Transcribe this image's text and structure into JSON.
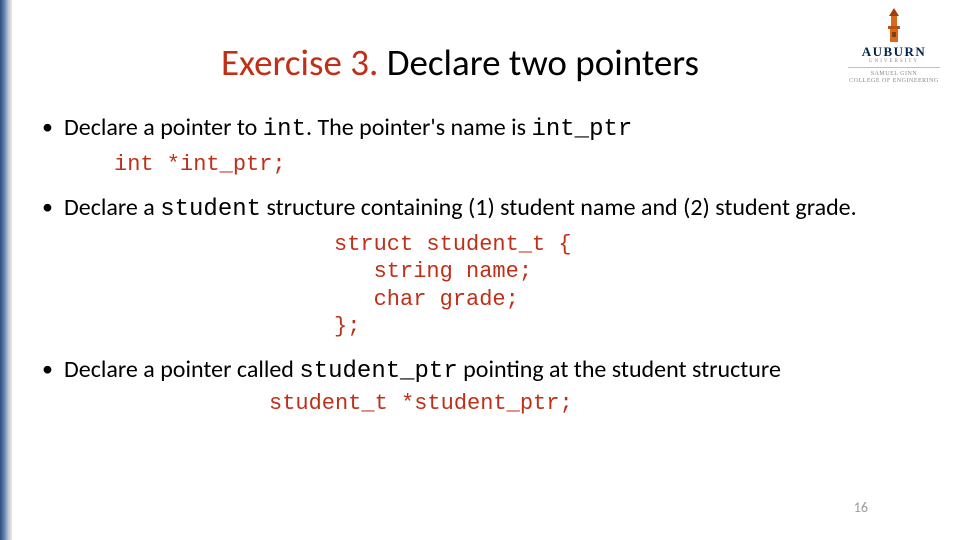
{
  "logo": {
    "word": "AUBURN",
    "sub": "UNIVERSITY",
    "college1": "SAMUEL GINN",
    "college2": "COLLEGE OF ENGINEERING"
  },
  "title": {
    "accent": "Exercise 3.",
    "rest": " Declare two pointers"
  },
  "bullets": {
    "b1": {
      "t1": "Declare a pointer to ",
      "c1": "int",
      "t2": ". The pointer's name is ",
      "c2": "int_ptr"
    },
    "code1": "int *int_ptr;",
    "b2": {
      "t1": "Declare a ",
      "c1": "student",
      "t2": " structure containing (1) student name and (2) student grade."
    },
    "code2": "struct student_t {\n   string name;\n   char grade;\n};",
    "b3": {
      "t1": "Declare a pointer called ",
      "c1": "student_ptr",
      "t2": " pointing at the student structure"
    },
    "code3": "student_t *student_ptr;"
  },
  "page": "16"
}
